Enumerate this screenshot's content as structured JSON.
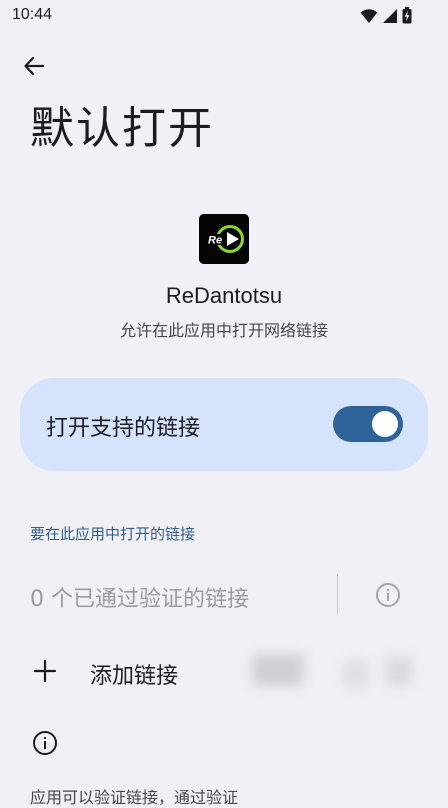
{
  "status_bar": {
    "time": "10:44",
    "icons": [
      "wifi-icon",
      "signal-icon",
      "battery-charging-icon"
    ]
  },
  "header": {
    "back_icon": "arrow-left-icon",
    "title": "默认打开"
  },
  "app": {
    "name": "ReDantotsu",
    "description": "允许在此应用中打开网络链接",
    "icon_text": "Re"
  },
  "open_supported_links": {
    "label": "打开支持的链接",
    "enabled": true
  },
  "links_section": {
    "header": "要在此应用中打开的链接",
    "verified_links": "0 个已通过验证的链接",
    "add_link_label": "添加链接"
  },
  "footer": {
    "text": "应用可以验证链接，通过验证"
  },
  "colors": {
    "background": "#f1f0f6",
    "card": "#d6e3fc",
    "switch_track": "#2f6298",
    "section_header": "#2f5f8f"
  }
}
